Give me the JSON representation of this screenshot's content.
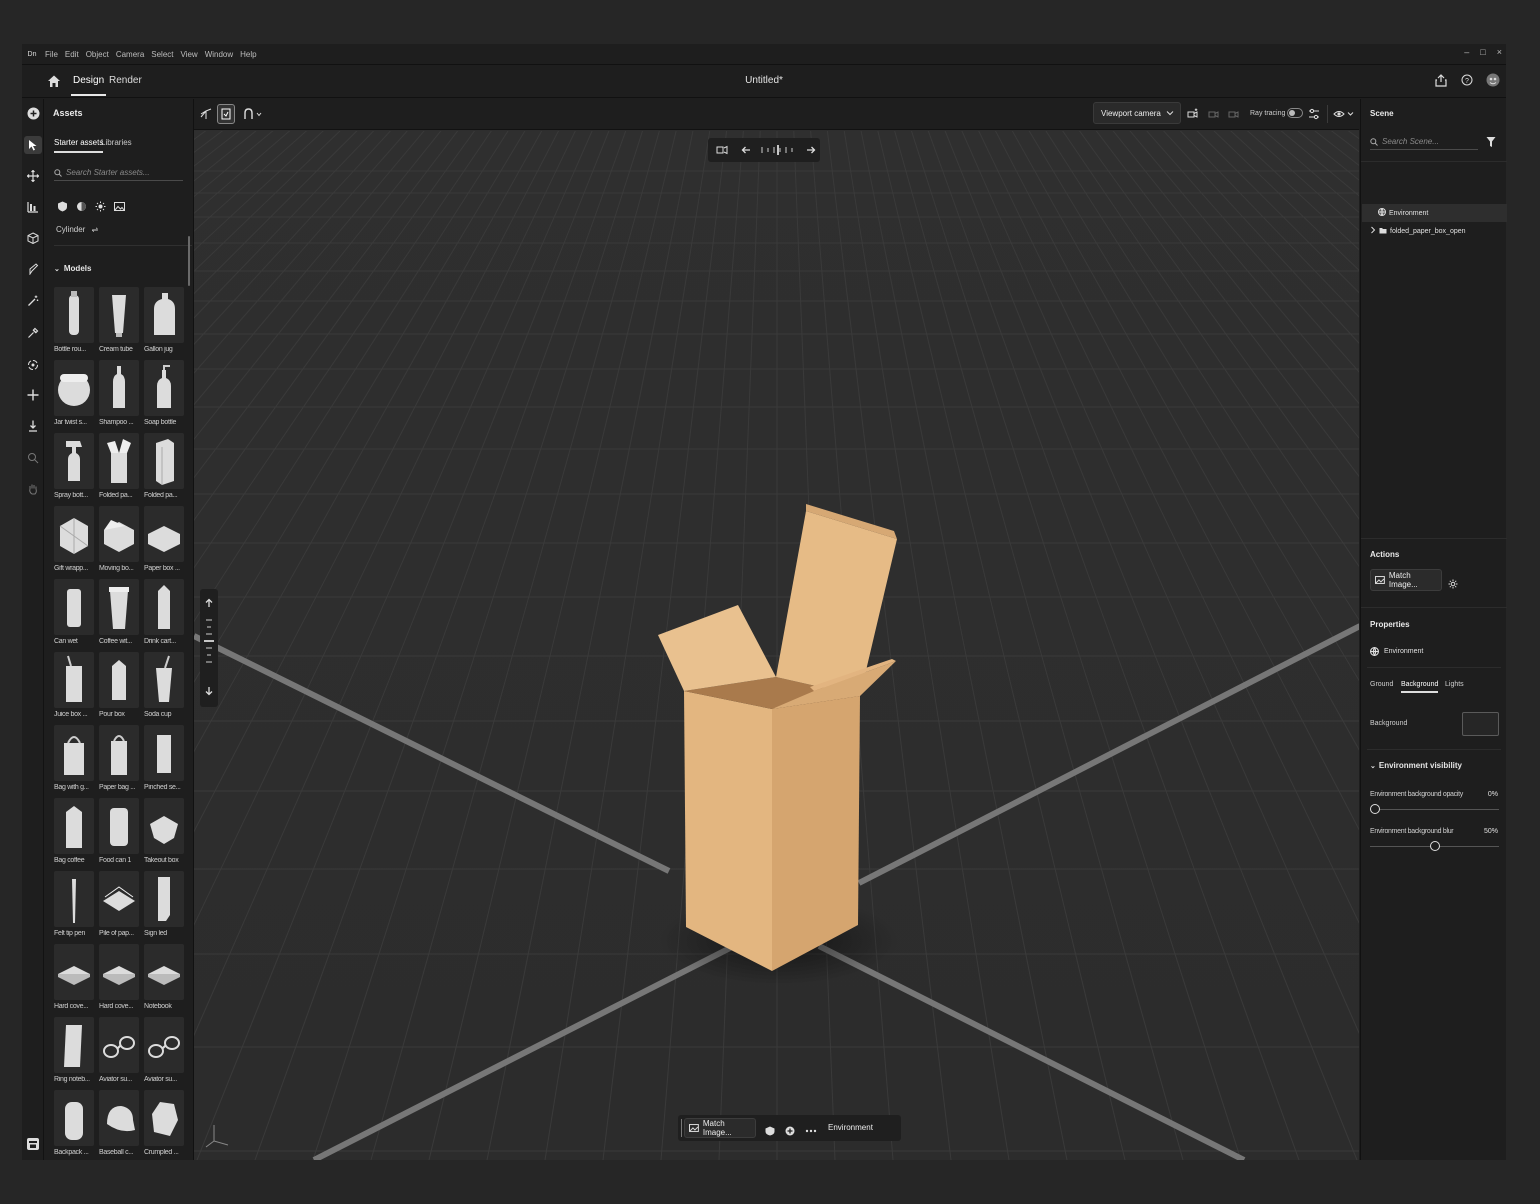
{
  "menubar": {
    "logo": "Dn",
    "items": [
      "File",
      "Edit",
      "Object",
      "Camera",
      "Select",
      "View",
      "Window",
      "Help"
    ],
    "window_controls": [
      "–",
      "□",
      "×"
    ]
  },
  "appbar": {
    "tabs": [
      "Design",
      "Render"
    ],
    "active_tab": "Design",
    "doc_title": "Untitled*"
  },
  "assets": {
    "title": "Assets",
    "subtabs": [
      "Starter assets",
      "Libraries"
    ],
    "search_placeholder": "Search Starter assets...",
    "filter_label": "Cylinder",
    "section": "Models",
    "models": [
      {
        "label": "Bottle rou...",
        "icon": "bottle"
      },
      {
        "label": "Cream tube",
        "icon": "tube"
      },
      {
        "label": "Gallon jug",
        "icon": "jug"
      },
      {
        "label": "Jar twist s...",
        "icon": "jar"
      },
      {
        "label": "Shampoo ...",
        "icon": "shampoo"
      },
      {
        "label": "Soap bottle",
        "icon": "soap"
      },
      {
        "label": "Spray bott...",
        "icon": "spray"
      },
      {
        "label": "Folded pa...",
        "icon": "openbox"
      },
      {
        "label": "Folded pa...",
        "icon": "box"
      },
      {
        "label": "Gift wrapp...",
        "icon": "gift"
      },
      {
        "label": "Moving bo...",
        "icon": "movingbox"
      },
      {
        "label": "Paper box ...",
        "icon": "flatbox"
      },
      {
        "label": "Can wet",
        "icon": "can"
      },
      {
        "label": "Coffee wit...",
        "icon": "cup"
      },
      {
        "label": "Drink cart...",
        "icon": "carton"
      },
      {
        "label": "Juice box ...",
        "icon": "juicebox"
      },
      {
        "label": "Pour box",
        "icon": "pourbox"
      },
      {
        "label": "Soda cup",
        "icon": "sodacup"
      },
      {
        "label": "Bag with g...",
        "icon": "bag"
      },
      {
        "label": "Paper bag ...",
        "icon": "paperbag"
      },
      {
        "label": "Pinched se...",
        "icon": "pouch"
      },
      {
        "label": "Bag coffee",
        "icon": "coffeebag"
      },
      {
        "label": "Food can 1",
        "icon": "foodcan"
      },
      {
        "label": "Takeout box",
        "icon": "takeout"
      },
      {
        "label": "Felt tip pen",
        "icon": "pen"
      },
      {
        "label": "Pile of pap...",
        "icon": "papers"
      },
      {
        "label": "Sign led",
        "icon": "sign"
      },
      {
        "label": "Hard cove...",
        "icon": "book"
      },
      {
        "label": "Hard cove...",
        "icon": "book"
      },
      {
        "label": "Notebook",
        "icon": "book"
      },
      {
        "label": "Ring noteb...",
        "icon": "ringbook"
      },
      {
        "label": "Aviator su...",
        "icon": "glasses"
      },
      {
        "label": "Aviator su...",
        "icon": "glasses"
      },
      {
        "label": "Backpack ...",
        "icon": "backpack"
      },
      {
        "label": "Baseball c...",
        "icon": "cap"
      },
      {
        "label": "Crumpled ...",
        "icon": "crumpled"
      }
    ]
  },
  "viewport": {
    "camera_select": "Viewport camera",
    "ray_tracing_label": "Ray tracing",
    "ray_tracing_on": false,
    "bottom_match": "Match Image...",
    "bottom_env": "Environment"
  },
  "scene": {
    "title": "Scene",
    "search_placeholder": "Search Scene...",
    "items": [
      {
        "label": "Environment",
        "selected": true
      },
      {
        "label": "folded_paper_box_open",
        "selected": false
      }
    ]
  },
  "actions": {
    "title": "Actions",
    "match_image": "Match Image..."
  },
  "properties": {
    "title": "Properties",
    "object": "Environment",
    "tabs": [
      "Ground",
      "Background",
      "Lights"
    ],
    "active_tab": "Background",
    "background_label": "Background",
    "background_color": "#262626",
    "visibility_title": "Environment visibility",
    "opacity_label": "Environment background opacity",
    "opacity_value": "0%",
    "opacity": 0,
    "blur_label": "Environment background blur",
    "blur_value": "50%",
    "blur": 0.5
  },
  "colors": {
    "box": "#e4b883",
    "box_shadow": "#c49463",
    "box_inner": "#d8a672",
    "accent": "#e8e8e8"
  }
}
